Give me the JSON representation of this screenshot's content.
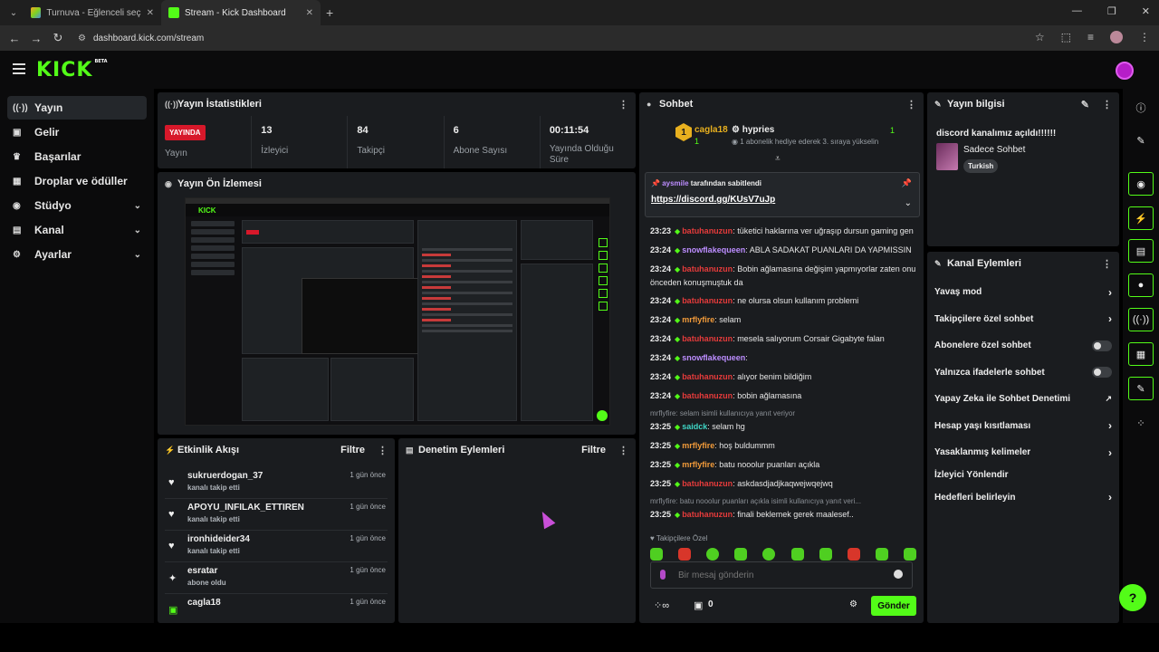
{
  "browser": {
    "tabs": [
      {
        "title": "Turnuva - Eğlenceli seçimler yap"
      },
      {
        "title": "Stream - Kick Dashboard"
      }
    ],
    "url": "dashboard.kick.com/stream"
  },
  "app": {
    "logo": "KICK",
    "logo_badge": "BETA"
  },
  "sidebar": {
    "items": [
      {
        "label": "Yayın",
        "icon": "broadcast-icon"
      },
      {
        "label": "Gelir",
        "icon": "revenue-icon"
      },
      {
        "label": "Başarılar",
        "icon": "trophy-icon"
      },
      {
        "label": "Droplar ve ödüller",
        "icon": "drops-icon"
      },
      {
        "label": "Stüdyo",
        "icon": "studio-icon"
      },
      {
        "label": "Kanal",
        "icon": "channel-icon"
      },
      {
        "label": "Ayarlar",
        "icon": "gear-icon"
      }
    ]
  },
  "stats_panel": {
    "title": "Yayın İstatistikleri",
    "badge": "YAYINDA",
    "items": [
      {
        "value": "",
        "label": "Yayın"
      },
      {
        "value": "13",
        "label": "İzleyici"
      },
      {
        "value": "84",
        "label": "Takipçi"
      },
      {
        "value": "6",
        "label": "Abone Sayısı"
      },
      {
        "value": "00:11:54",
        "label": "Yayında Olduğu Süre"
      }
    ]
  },
  "preview_panel": {
    "title": "Yayın Ön İzlemesi"
  },
  "activity_panel": {
    "title": "Etkinlik Akışı",
    "filter": "Filtre",
    "items": [
      {
        "name": "sukruerdogan_37",
        "sub": "kanalı takip etti",
        "time": "1 gün önce"
      },
      {
        "name": "APOYU_INFILAK_ETTIREN",
        "sub": "kanalı takip etti",
        "time": "1 gün önce"
      },
      {
        "name": "ironhideider34",
        "sub": "kanalı takip etti",
        "time": "1 gün önce"
      },
      {
        "name": "esratar",
        "sub": "abone oldu",
        "time": "1 gün önce"
      },
      {
        "name": "cagla18",
        "sub": "",
        "time": "1 gün önce"
      }
    ]
  },
  "moderation_panel": {
    "title": "Denetim Eylemleri",
    "filter": "Filtre"
  },
  "chat": {
    "title": "Sohbet",
    "top": {
      "rank": "1",
      "user": "cagla18",
      "user_count": "1",
      "gifter": "hypries",
      "gifter_note": "1 abonelik hediye ederek 3. sıraya yükselin",
      "gifter_count": "1"
    },
    "pinned": {
      "by_user": "aysmile",
      "by_text": "tarafından sabitlendi",
      "link": "https://discord.gg/KUsV7uJp"
    },
    "messages": [
      {
        "time": "23:23",
        "user": "batuhanuzun",
        "color": "#e53b3b",
        "text": ": tüketici haklarına ver uğraşıp dursun gaming gen"
      },
      {
        "time": "23:24",
        "user": "snowflakequeen",
        "color": "#bc8dff",
        "text": ": ABLA SADAKAT PUANLARI DA YAPMISSIN"
      },
      {
        "time": "23:24",
        "user": "batuhanuzun",
        "color": "#e53b3b",
        "text": ": Bobin ağlamasına değişim yapmıyorlar zaten onu önceden konuşmuştuk da"
      },
      {
        "time": "23:24",
        "user": "batuhanuzun",
        "color": "#e53b3b",
        "text": ": ne olursa olsun kullanım problemi"
      },
      {
        "time": "23:24",
        "user": "mrflyfire",
        "color": "#f29b3a",
        "text": ": selam"
      },
      {
        "time": "23:24",
        "user": "batuhanuzun",
        "color": "#e53b3b",
        "text": ": mesela salıyorum Corsair Gigabyte falan"
      },
      {
        "time": "23:24",
        "user": "snowflakequeen",
        "color": "#bc8dff",
        "text": ":"
      },
      {
        "time": "23:24",
        "user": "batuhanuzun",
        "color": "#e53b3b",
        "text": ": alıyor benim bildiğim"
      },
      {
        "time": "23:24",
        "user": "batuhanuzun",
        "color": "#e53b3b",
        "text": ": bobin ağlamasına"
      },
      {
        "reply": "mrflyfire: selam isimli kullanıcıya yanıt veriyor",
        "time": "23:25",
        "user": "saidck",
        "color": "#3fd6c6",
        "text": ": selam hg"
      },
      {
        "time": "23:25",
        "user": "mrflyfire",
        "color": "#f29b3a",
        "text": ": hoş buldummm"
      },
      {
        "time": "23:25",
        "user": "mrflyfire",
        "color": "#f29b3a",
        "text": ": batu nooolur puanları açıkla"
      },
      {
        "time": "23:25",
        "user": "batuhanuzun",
        "color": "#e53b3b",
        "text": ": askdasdjadjkaqwejwqejwq"
      },
      {
        "reply": "mrflyfire: batu nooolur puanları açıkla isimli kullanıcıya yanıt veri...",
        "time": "23:25",
        "user": "batuhanuzun",
        "color": "#e53b3b",
        "text": ": finali beklemek gerek maalesef.."
      }
    ],
    "emote_label": "Takipçilere Özel",
    "input_placeholder": "Bir mesaj gönderin",
    "points": "0",
    "send_label": "Gönder"
  },
  "info_panel": {
    "title": "Yayın bilgisi",
    "stream_title": "discord kanalımız açıldı!!!!!!",
    "category": "Sadece Sohbet",
    "tag": "Turkish"
  },
  "channel_actions": {
    "title": "Kanal Eylemleri",
    "items": [
      {
        "label": "Yavaş mod",
        "kind": "arrow"
      },
      {
        "label": "Takipçilere özel sohbet",
        "kind": "arrow"
      },
      {
        "label": "Abonelere özel sohbet",
        "kind": "toggle"
      },
      {
        "label": "Yalnızca ifadelerle sohbet",
        "kind": "toggle"
      },
      {
        "label": "Yapay Zeka ile Sohbet Denetimi",
        "kind": "external"
      },
      {
        "label": "Hesap yaşı kısıtlaması",
        "kind": "arrow"
      },
      {
        "label": "Yasaklanmış kelimeler",
        "kind": "arrow"
      },
      {
        "label": "İzleyici Yönlendir",
        "kind": "none"
      },
      {
        "label": "Hedefleri belirleyin",
        "kind": "arrow"
      }
    ]
  },
  "colors": {
    "accent": "#53fc18",
    "live": "#d7182a",
    "panel": "#1a1c1f",
    "background": "#0b0b0c"
  }
}
